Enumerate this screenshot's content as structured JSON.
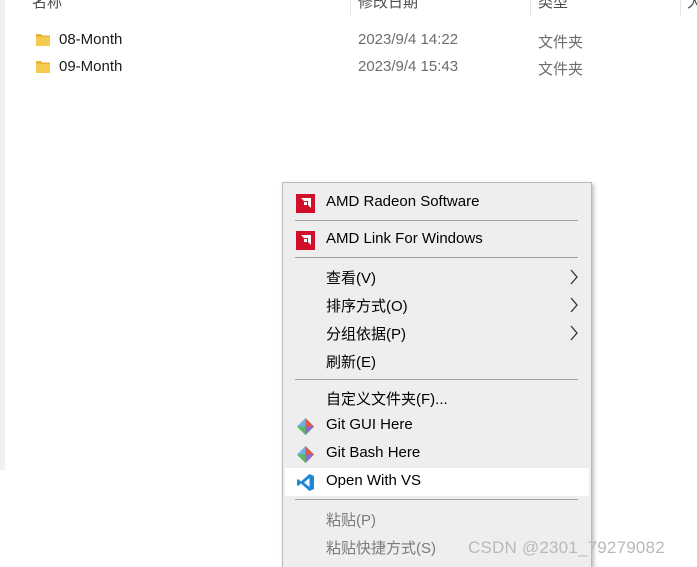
{
  "columns": {
    "name": "名称",
    "modified": "修改日期",
    "type": "类型",
    "size": "大"
  },
  "files": [
    {
      "name": "08-Month",
      "date": "2023/9/4 14:22",
      "type": "文件夹",
      "icon": "folder-icon"
    },
    {
      "name": "09-Month",
      "date": "2023/9/4 15:43",
      "type": "文件夹",
      "icon": "folder-icon"
    }
  ],
  "context_menu": {
    "items": [
      {
        "label": "AMD Radeon Software",
        "icon": "amd-icon"
      },
      {
        "label": "AMD Link For Windows",
        "icon": "amd-icon"
      },
      {
        "label": "查看(V)",
        "submenu": true
      },
      {
        "label": "排序方式(O)",
        "submenu": true
      },
      {
        "label": "分组依据(P)",
        "submenu": true
      },
      {
        "label": "刷新(E)"
      },
      {
        "label": "自定义文件夹(F)..."
      },
      {
        "label": "Git GUI Here",
        "icon": "git-icon"
      },
      {
        "label": "Git Bash Here",
        "icon": "git-icon"
      },
      {
        "label": "Open With VS",
        "icon": "vscode-icon",
        "highlighted": true
      },
      {
        "label": "粘贴(P)",
        "disabled": true
      },
      {
        "label": "粘贴快捷方式(S)",
        "disabled": true
      }
    ]
  },
  "watermark": "CSDN @2301_79279082",
  "colors": {
    "amd_red": "#d0102a",
    "folder_yellow": "#f6c94f",
    "vscode_blue": "#1e88d6"
  }
}
